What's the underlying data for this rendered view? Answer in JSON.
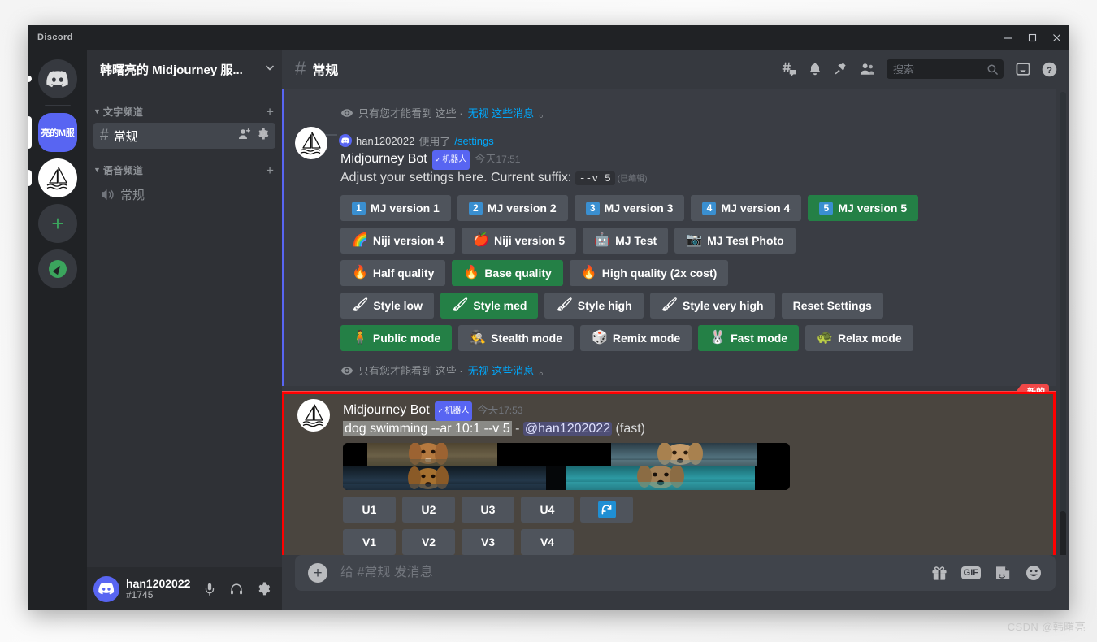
{
  "window": {
    "app_title": "Discord",
    "controls": {
      "minimize": "minimize-icon",
      "maximize": "maximize-icon",
      "close": "close-icon"
    }
  },
  "watermark": "CSDN @韩曙亮",
  "server_rail": {
    "items": [
      {
        "name": "home",
        "label": "",
        "type": "home-icon",
        "pill": "sm"
      },
      {
        "name": "midjourney-guild",
        "label": "亮的M服",
        "type": "selected-guild",
        "pill": "lg"
      },
      {
        "name": "midjourney-bot-dm",
        "label": "",
        "type": "sailboat-icon",
        "pill": "md"
      },
      {
        "name": "add-server",
        "label": "+",
        "type": "plus-icon",
        "pill": ""
      },
      {
        "name": "explore-servers",
        "label": "",
        "type": "compass-icon",
        "pill": ""
      }
    ]
  },
  "sidebar": {
    "guild_name": "韩曙亮的 Midjourney 服...",
    "categories": [
      {
        "label": "文字频道",
        "add_label": "+",
        "channels": [
          {
            "name": "常规",
            "type": "text",
            "active": true,
            "actions": [
              "add-member-icon",
              "settings-icon"
            ]
          }
        ]
      },
      {
        "label": "语音频道",
        "add_label": "+",
        "channels": [
          {
            "name": "常规",
            "type": "voice",
            "active": false,
            "actions": []
          }
        ]
      }
    ],
    "user": {
      "name": "han1202022",
      "tag": "#1745",
      "buttons": [
        "microphone-icon",
        "headphones-icon",
        "user-settings-gear-icon"
      ]
    }
  },
  "header": {
    "channel": "常规",
    "icons": [
      "threads-icon",
      "notification-bell-icon",
      "pinned-messages-icon",
      "member-list-icon"
    ],
    "search_placeholder": "搜索",
    "search_value": "",
    "right_icons": [
      "inbox-icon",
      "help-icon"
    ]
  },
  "messages": {
    "ephemeral_note_top": {
      "prefix": "只有您才能看到 这些 · ",
      "link": "无视 这些消息",
      "suffix": "。"
    },
    "settings_message": {
      "command_user": "han1202022",
      "command_verb": "使用了",
      "command_name": "/settings",
      "author": "Midjourney Bot",
      "bot_tag": "机器人",
      "timestamp_day": "今天",
      "timestamp_time": "17:51",
      "text_prefix": "Adjust your settings here. Current suffix:",
      "suffix_code": "--v 5",
      "edited_label": "(已编辑)",
      "button_rows": [
        [
          {
            "label": "MJ version 1",
            "badge": "1",
            "style": "grey"
          },
          {
            "label": "MJ version 2",
            "badge": "2",
            "style": "grey"
          },
          {
            "label": "MJ version 3",
            "badge": "3",
            "style": "grey"
          },
          {
            "label": "MJ version 4",
            "badge": "4",
            "style": "grey"
          },
          {
            "label": "MJ version 5",
            "badge": "5",
            "style": "green"
          }
        ],
        [
          {
            "label": "Niji version 4",
            "emoji": "🌈",
            "style": "grey"
          },
          {
            "label": "Niji version 5",
            "emoji": "🍎",
            "style": "grey"
          },
          {
            "label": "MJ Test",
            "emoji": "🤖",
            "style": "grey"
          },
          {
            "label": "MJ Test Photo",
            "emoji": "📷",
            "style": "grey"
          }
        ],
        [
          {
            "label": "Half quality",
            "emoji": "🔥",
            "style": "grey"
          },
          {
            "label": "Base quality",
            "emoji": "🔥",
            "style": "green"
          },
          {
            "label": "High quality (2x cost)",
            "emoji": "🔥",
            "style": "grey"
          }
        ],
        [
          {
            "label": "Style low",
            "emoji": "🖌",
            "style": "grey"
          },
          {
            "label": "Style med",
            "emoji": "🖌",
            "style": "green"
          },
          {
            "label": "Style high",
            "emoji": "🖌",
            "style": "grey"
          },
          {
            "label": "Style very high",
            "emoji": "🖌",
            "style": "grey"
          },
          {
            "label": "Reset Settings",
            "emoji": "",
            "style": "grey"
          }
        ],
        [
          {
            "label": "Public mode",
            "emoji": "🧍",
            "style": "green"
          },
          {
            "label": "Stealth mode",
            "emoji": "🕵",
            "style": "grey"
          },
          {
            "label": "Remix mode",
            "emoji": "🎲",
            "style": "grey"
          },
          {
            "label": "Fast mode",
            "emoji": "🐰",
            "style": "green"
          },
          {
            "label": "Relax mode",
            "emoji": "🐢",
            "style": "grey"
          }
        ]
      ]
    },
    "ephemeral_note_bottom": {
      "prefix": "只有您才能看到 这些 · ",
      "link": "无视 这些消息",
      "suffix": "。"
    },
    "new_divider_label": "新的",
    "imagine_message": {
      "author": "Midjourney Bot",
      "bot_tag": "机器人",
      "timestamp_day": "今天",
      "timestamp_time": "17:53",
      "prompt": "dog swimming --ar 10:1 --v 5",
      "separator": "-",
      "mention": "@han1202022",
      "mode": "(fast)",
      "image_alt": "4-up grid of a dog swimming",
      "upscale_buttons": [
        "U1",
        "U2",
        "U3",
        "U4"
      ],
      "reroll_button": "reroll-icon",
      "variation_buttons": [
        "V1",
        "V2",
        "V3",
        "V4"
      ]
    }
  },
  "composer": {
    "placeholder": "给 #常规 发消息",
    "value": "",
    "add_button": "+",
    "icons": [
      "gift-icon",
      "gif-icon",
      "sticker-icon",
      "emoji-icon"
    ],
    "gif_label": "GIF"
  },
  "colors": {
    "accent_blurple": "#5865f2",
    "green_selected": "#248046",
    "red_highlight": "#ff0000",
    "new_badge": "#f04747",
    "link_blue": "#00a8fc"
  }
}
